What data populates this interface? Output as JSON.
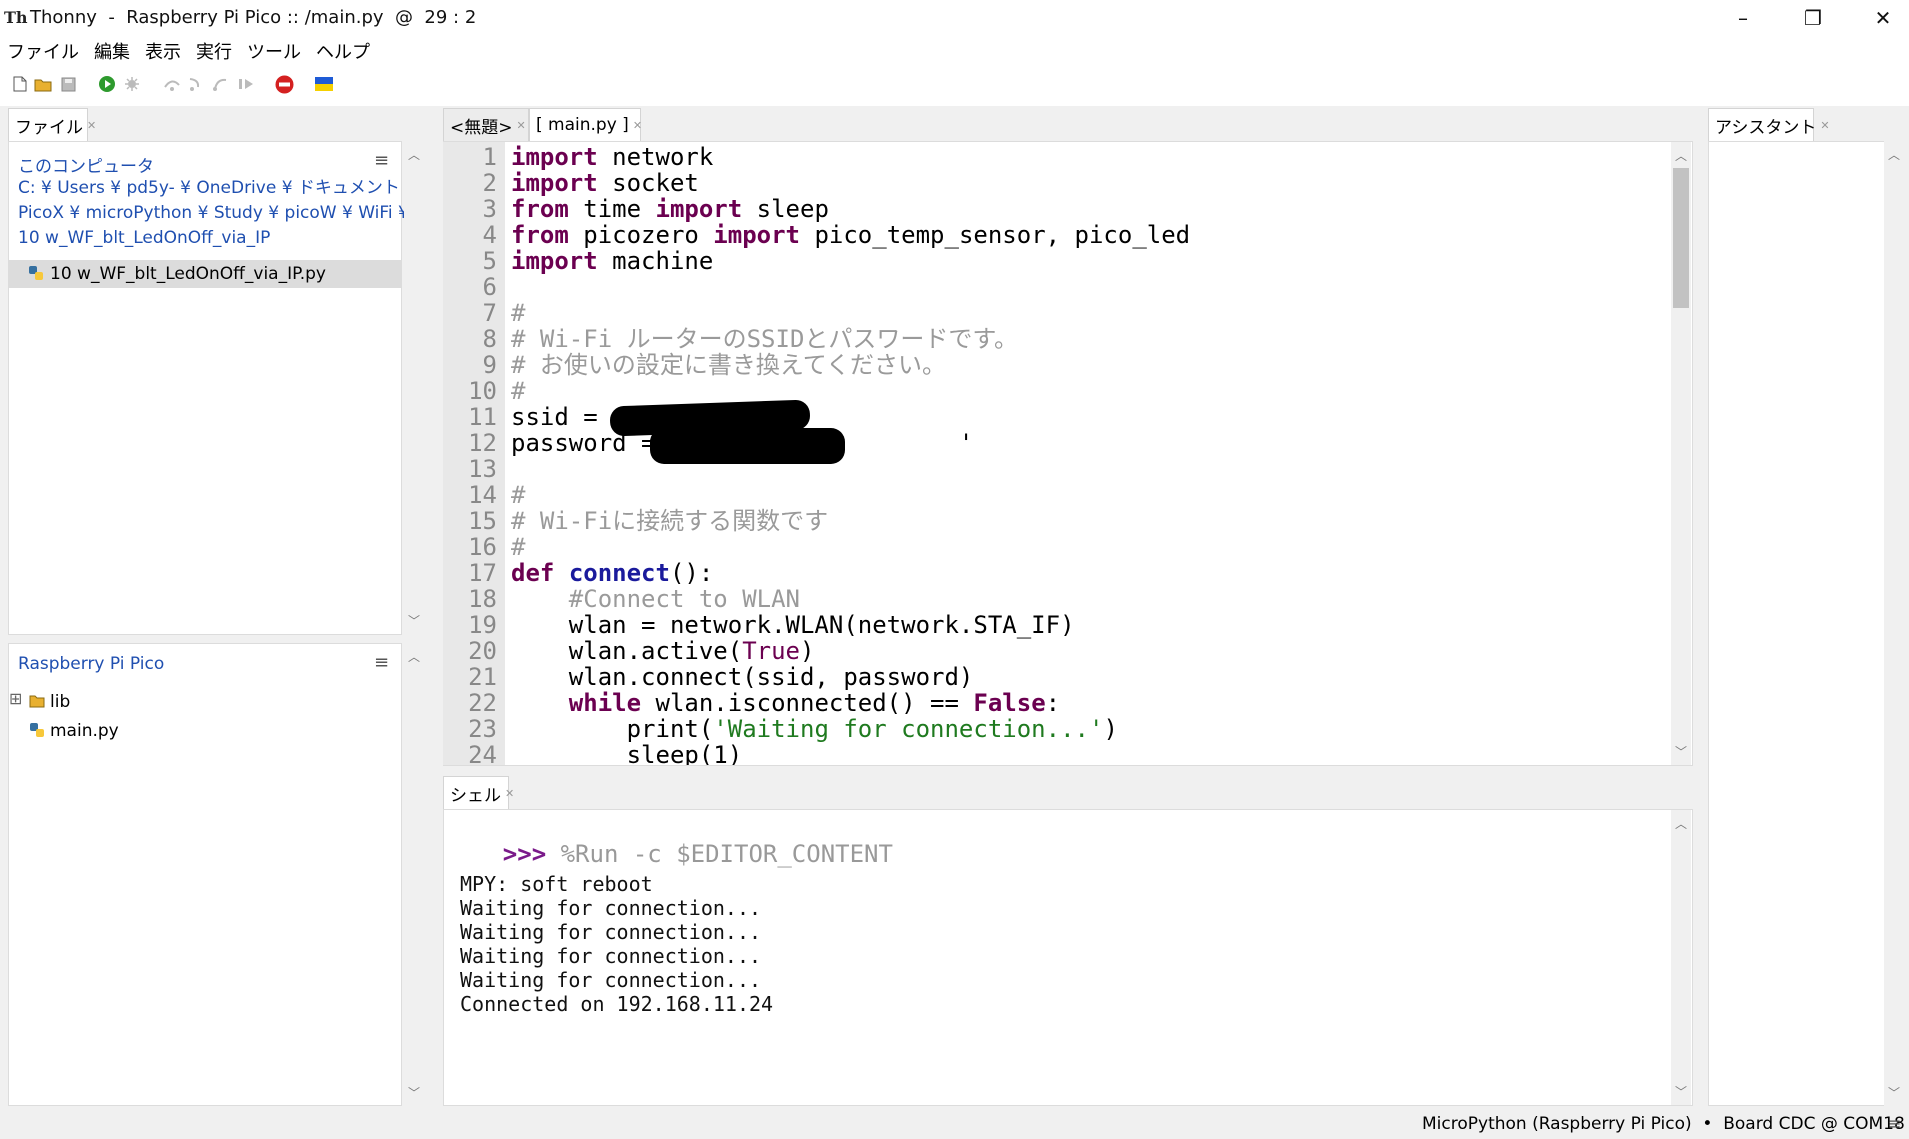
{
  "window": {
    "title": "Thonny  -  Raspberry Pi Pico :: /main.py  @  29 : 2",
    "app_icon_text": "Th",
    "minimize": "–",
    "restore": "❐",
    "close": "✕"
  },
  "menu": [
    "ファイル",
    "編集",
    "表示",
    "実行",
    "ツール",
    "ヘルプ"
  ],
  "files_panel": {
    "tab_label": "ファイル",
    "this_computer_label": "このコンピュータ",
    "path_lines": [
      "C: ¥ Users ¥ pd5y- ¥ OneDrive ¥ ドキュメント ¥",
      "PicoX ¥ microPython ¥ Study ¥ picoW ¥ WiFi ¥",
      "10 w_WF_blt_LedOnOff_via_IP"
    ],
    "selected_file": "10 w_WF_blt_LedOnOff_via_IP.py",
    "device_label": "Raspberry Pi Pico",
    "device_items": [
      "lib",
      "main.py"
    ],
    "expand_glyph": "⊞",
    "menu_glyph": "≡"
  },
  "editor": {
    "tabs": [
      "<無題>",
      "[ main.py ]"
    ],
    "line_numbers": [
      "1",
      "2",
      "3",
      "4",
      "5",
      "6",
      "7",
      "8",
      "9",
      "10",
      "11",
      "12",
      "13",
      "14",
      "15",
      "16",
      "17",
      "18",
      "19",
      "20",
      "21",
      "22",
      "23",
      "24"
    ]
  },
  "assistant": {
    "tab_label": "アシスタント"
  },
  "shell": {
    "tab_label": "シェル",
    "prompt": ">>>",
    "command": " %Run -c $EDITOR_CONTENT",
    "output": [
      "MPY: soft reboot",
      "Waiting for connection...",
      "Waiting for connection...",
      "Waiting for connection...",
      "Waiting for connection...",
      "Connected on 192.168.11.24"
    ]
  },
  "status": {
    "text": "MicroPython (Raspberry Pi Pico)  •  Board CDC @ COM18",
    "menu_glyph": "≡"
  },
  "colors": {
    "keyword": "#6b0050",
    "comment": "#9a9a9a",
    "string": "#1f7a1f",
    "link": "#1f4fb0"
  }
}
